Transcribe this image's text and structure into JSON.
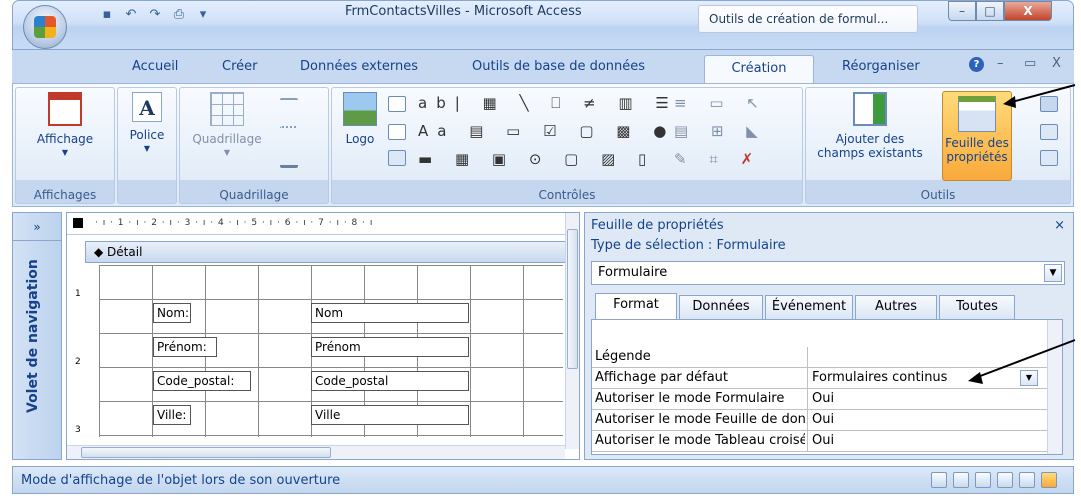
{
  "window": {
    "title": "FrmContactsVilles - Microsoft Access",
    "context_tab": "Outils de création de formul...",
    "minimize": "–",
    "maximize": "□",
    "close": "X"
  },
  "ribbon_tabs": [
    "Accueil",
    "Créer",
    "Données externes",
    "Outils de base de données",
    "Création",
    "Réorganiser"
  ],
  "ribbon": {
    "affichages": {
      "button": "Affichage",
      "label": "Affichages"
    },
    "police": {
      "button": "Police"
    },
    "quadrillage": {
      "button": "Quadrillage",
      "label": "Quadrillage"
    },
    "controles": {
      "logo": "Logo",
      "label": "Contrôles"
    },
    "outils": {
      "ajouter_line1": "Ajouter des",
      "ajouter_line2": "champs existants",
      "feuille_line1": "Feuille des",
      "feuille_line2": "propriétés",
      "label": "Outils"
    }
  },
  "navpane": {
    "toggle": "»",
    "label": "Volet de navigation"
  },
  "designer": {
    "ruler": "· ı · 1 · ı · 2 · ı · 3 · ı · 4 · ı · 5 · ı · 6 · ı · 7 · ı · 8 · ı",
    "section": "Détail",
    "controls": [
      {
        "label": "Nom:",
        "field": "Nom"
      },
      {
        "label": "Prénom:",
        "field": "Prénom"
      },
      {
        "label": "Code_postal:",
        "field": "Code_postal"
      },
      {
        "label": "Ville:",
        "field": "Ville"
      }
    ],
    "vruler": [
      "1",
      "2",
      "3"
    ]
  },
  "property_sheet": {
    "title": "Feuille de propriétés",
    "close": "×",
    "selection_type": "Type de sélection : Formulaire",
    "selection": "Formulaire",
    "tabs": [
      "Format",
      "Données",
      "Événement",
      "Autres",
      "Toutes"
    ],
    "rows": [
      {
        "name": "Légende",
        "value": ""
      },
      {
        "name": "Affichage par défaut",
        "value": "Formulaires continus"
      },
      {
        "name": "Autoriser le mode Formulaire",
        "value": "Oui"
      },
      {
        "name": "Autoriser le mode Feuille de données",
        "value": "Oui"
      },
      {
        "name": "Autoriser le mode Tableau croisé",
        "value": "Oui"
      }
    ]
  },
  "status_bar": {
    "text": "Mode d'affichage de l'objet lors de son ouverture"
  }
}
